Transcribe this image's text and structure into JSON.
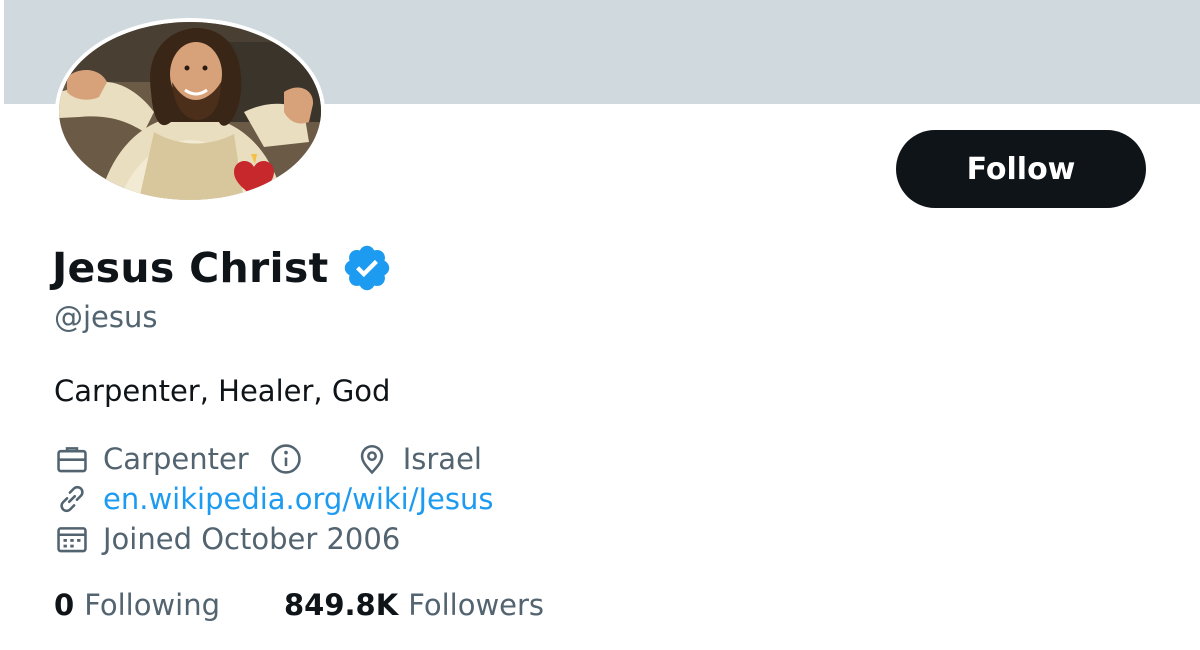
{
  "profile": {
    "display_name": "Jesus Christ",
    "handle": "@jesus",
    "bio": "Carpenter, Healer, God",
    "verified": true,
    "professional_category": "Carpenter",
    "location": "Israel",
    "url": "en.wikipedia.org/wiki/Jesus",
    "joined": "Joined October 2006"
  },
  "actions": {
    "follow_label": "Follow"
  },
  "stats": {
    "following_count": "0",
    "following_label": "Following",
    "followers_count": "849.8K",
    "followers_label": "Followers"
  },
  "icons": {
    "verified": "verified-badge-icon",
    "category": "briefcase-icon",
    "info": "info-icon",
    "location": "location-pin-icon",
    "link": "link-icon",
    "joined": "calendar-icon"
  },
  "colors": {
    "banner": "#cfd9de",
    "accent_blue": "#1d9bf0",
    "text_primary": "#0f1419",
    "text_secondary": "#536471",
    "follow_button_bg": "#0f1419"
  }
}
